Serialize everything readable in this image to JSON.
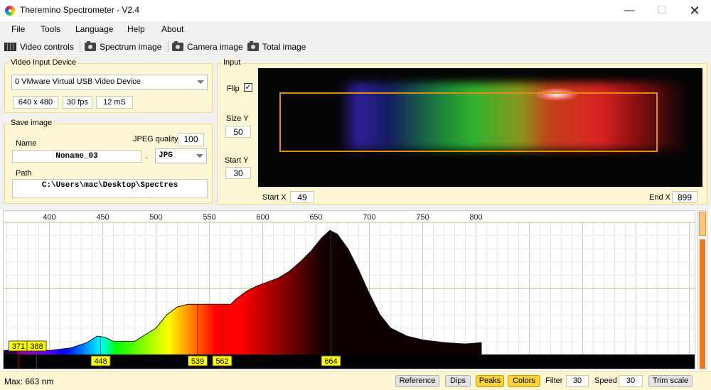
{
  "window": {
    "title": "Theremino Spectrometer - V2.4",
    "minimize": "—",
    "maximize": "☐",
    "close": "✕"
  },
  "menu": [
    "File",
    "Tools",
    "Language",
    "Help",
    "About"
  ],
  "toolbar": {
    "video_controls": "Video controls",
    "spectrum_image": "Spectrum image",
    "camera_image": "Camera image",
    "total_image": "Total image"
  },
  "video_input": {
    "title": "Video Input Device",
    "device": "0 VMware Virtual USB Video Device",
    "resolution": "640 x 480",
    "fps": "30 fps",
    "latency": "12 mS"
  },
  "save_image": {
    "title": "Save image",
    "name_label": "Name",
    "jpeg_quality_label": "JPEG quality",
    "jpeg_quality": "100",
    "filename": "Noname_03",
    "dot": ".",
    "format": "JPG",
    "path_label": "Path",
    "path": "C:\\Users\\mac\\Desktop\\Spectres"
  },
  "input": {
    "title": "Input",
    "flip_label": "Flip",
    "flip_checked": "✓",
    "size_y_label": "Size Y",
    "size_y": "50",
    "start_y_label": "Start Y",
    "start_y": "30",
    "start_x_label": "Start X",
    "start_x": "49",
    "end_x_label": "End X",
    "end_x": "899"
  },
  "chart_data": {
    "type": "area",
    "xlim": [
      357,
      1005
    ],
    "ylim": [
      0,
      100
    ],
    "x_ticks": [
      400,
      450,
      500,
      550,
      600,
      650,
      700,
      750,
      800
    ],
    "grid": true,
    "x": [
      357,
      380,
      400,
      420,
      435,
      445,
      452,
      460,
      480,
      500,
      510,
      520,
      530,
      540,
      550,
      560,
      570,
      575,
      585,
      595,
      605,
      615,
      625,
      635,
      645,
      655,
      663,
      670,
      680,
      690,
      700,
      710,
      720,
      735,
      750,
      770,
      790,
      805
    ],
    "values": [
      3,
      4,
      3,
      5,
      9,
      14,
      13,
      10,
      10,
      20,
      30,
      36,
      38,
      38,
      38,
      38,
      38,
      42,
      48,
      52,
      55,
      58,
      63,
      70,
      78,
      88,
      94,
      91,
      80,
      64,
      46,
      30,
      20,
      14,
      11,
      9,
      8,
      9
    ],
    "peaks": [
      "371",
      "388",
      "448",
      "539",
      "562",
      "664"
    ],
    "peak_positions_nm": [
      371,
      388,
      448,
      539,
      562,
      664
    ]
  },
  "status": {
    "max_label": "Max: 663 nm",
    "reference": "Reference",
    "dips": "Dips",
    "peaks": "Peaks",
    "colors": "Colors",
    "filter_label": "Filter",
    "filter": "30",
    "speed_label": "Speed",
    "speed": "30",
    "trim_scale": "Trim scale"
  }
}
